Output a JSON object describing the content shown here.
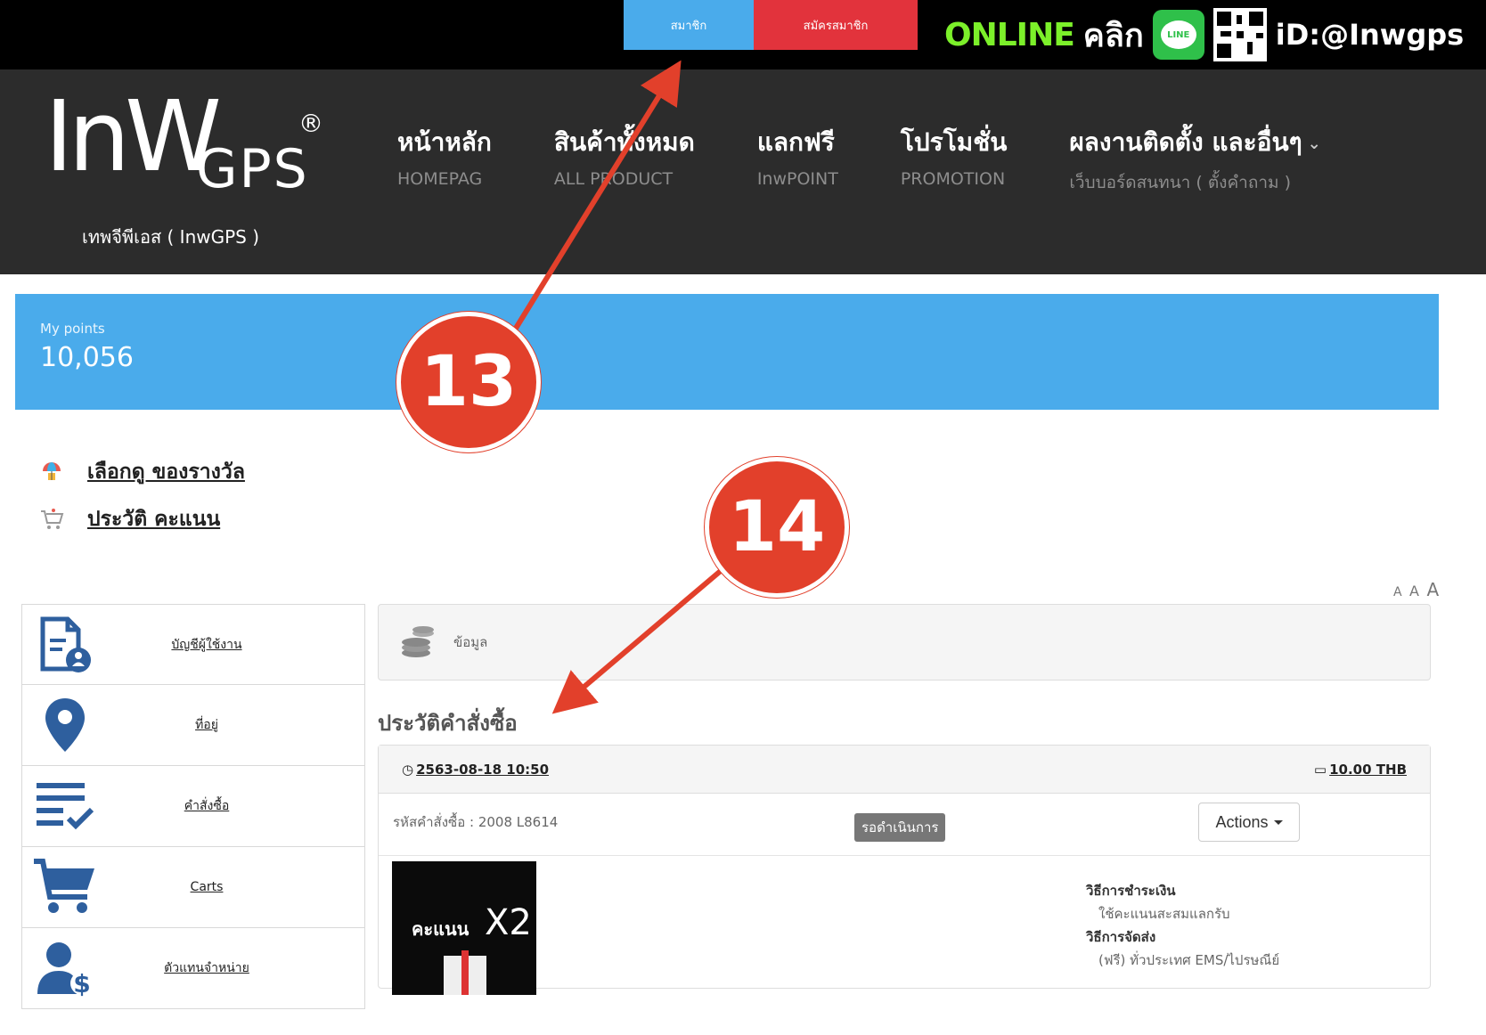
{
  "topbar": {
    "member_label": "สมาชิก",
    "register_label": "สมัครสมาชิก",
    "online_label": "ONLINE",
    "click_label": "คลิก",
    "line_badge": "LINE",
    "line_id": "iD:@Inwgps"
  },
  "header": {
    "logo_big": "InW",
    "logo_gps": "GPS",
    "logo_reg": "®",
    "logo_subtitle": "เทพจีพีเอส ( InwGPS )",
    "nav": [
      {
        "th": "หน้าหลัก",
        "en": "HOMEPAG"
      },
      {
        "th": "สินค้าทั้งหมด",
        "en": "ALL PRODUCT"
      },
      {
        "th": "แลกฟรี",
        "en": "InwPOINT"
      },
      {
        "th": "โปรโมชั่น",
        "en": "PROMOTION"
      },
      {
        "th": "ผลงานติดตั้ง และอื่นๆ",
        "en": "เว็บบอร์ดสนทนา ( ตั้งคำถาม )"
      }
    ]
  },
  "points": {
    "label": "My points",
    "value": "10,056"
  },
  "links": [
    {
      "label": "เลือกดู ของรางวัล",
      "icon": "gift-umbrella-icon"
    },
    {
      "label": "ประวัติ คะแนน",
      "icon": "cart-icon"
    }
  ],
  "font_size_ctrl": [
    "A",
    "A",
    "A"
  ],
  "sidebar": [
    {
      "label": "บัญชีผู้ใช้งาน",
      "icon": "account-document-icon"
    },
    {
      "label": "ที่อยู่",
      "icon": "map-pin-icon"
    },
    {
      "label": "คำสั่งซื้อ",
      "icon": "order-list-icon"
    },
    {
      "label": "Carts",
      "icon": "shopping-cart-icon"
    },
    {
      "label": "ตัวแทนจำหน่าย",
      "icon": "dealer-icon"
    }
  ],
  "info_box": {
    "label": "ข้อมูล",
    "icon": "coins-icon"
  },
  "order_history_title": "ประวัติคำสั่งซื้อ",
  "order": {
    "date": "2563-08-18 10:50",
    "total": "10.00 THB",
    "code": "รหัสคำสั่งซื้อ : 2008 L8614",
    "status": "รอดำเนินการ",
    "actions_label": "Actions",
    "product_text": "คะแนน",
    "product_multiplier": "X2",
    "payment_heading": "วิธีการชำระเงิน",
    "payment_value": "ใช้คะแนนสะสมแลกรับ",
    "shipping_heading": "วิธีการจัดส่ง",
    "shipping_value": "(ฟรี) ทั่วประเทศ EMS/ไปรษณีย์"
  },
  "callouts": [
    "13",
    "14"
  ],
  "colors": {
    "accent_blue": "#4aabeb",
    "register_red": "#e2333c",
    "callout_red": "#e2402b",
    "header_dark": "#2c2c2c",
    "online_green": "#7cf02a",
    "icon_blue": "#2e5f9e"
  }
}
